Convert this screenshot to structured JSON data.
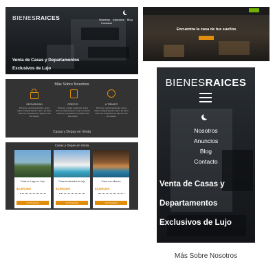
{
  "colors": {
    "accent": "#e08e0b",
    "green": "#71b100",
    "dark": "#333333",
    "white": "#ffffff"
  },
  "desktop_header": {
    "logo_light": "BIENES",
    "logo_bold": "RAICES",
    "nav": [
      "Nosotros",
      "Anuncios",
      "Blog",
      "Contacto"
    ],
    "theme_icon": "moon-icon",
    "headline": "Venta de Casas y Departamentos Exclusivos de Lujo"
  },
  "blog_header": {
    "nav_button": "",
    "title": "Encuentra la casa de tus sueños",
    "button": ""
  },
  "features": {
    "title": "Más Sobre Nosotros",
    "items": [
      {
        "icon": "lock-icon",
        "label": "SEGURIDAD",
        "text": "Possimus, suscipit repellendus. Autem dolore sit aliquid deleniti in ullam. Ea dolore modi amet voluptatibus est sapiente iusto eos suscipit."
      },
      {
        "icon": "price-tag-icon",
        "label": "PRECIO",
        "text": "Possimus, suscipit repellendus. Autem dolore sit aliquid deleniti in ullam. Ea dolore modi amet voluptatibus est sapiente iusto eos suscipit."
      },
      {
        "icon": "clock-icon",
        "label": "A TIEMPO",
        "text": "Possimus, suscipit repellendus. Autem dolore sit aliquid deleniti in ullam. Ea dolore modi amet voluptatibus est sapiente iusto eos suscipit."
      }
    ],
    "subtitle": "Casas y Depas en Venta"
  },
  "listings": {
    "title": "Casas y Depas en Venta",
    "cards": [
      {
        "title": "Casa en Lago en Lujo",
        "price": "$3,000,000",
        "button": "Ver Propiedad"
      },
      {
        "title": "Casa terminados de lujo",
        "price": "$3,000,000",
        "button": "Ver Propiedad"
      },
      {
        "title": "Casa con alberca",
        "price": "$3,000,000",
        "button": "Ver Propiedad"
      }
    ]
  },
  "mobile": {
    "logo_light": "BIENES",
    "logo_bold": "RAICES",
    "menu_icon": "hamburger-icon",
    "theme_icon": "moon-icon",
    "nav": [
      "Nosotros",
      "Anuncios",
      "Blog",
      "Contacto"
    ],
    "headline_lines": [
      "Venta de Casas y",
      "Departamentos",
      "Exclusivos de Lujo"
    ],
    "below_title": "Más Sobre Nosotros"
  }
}
